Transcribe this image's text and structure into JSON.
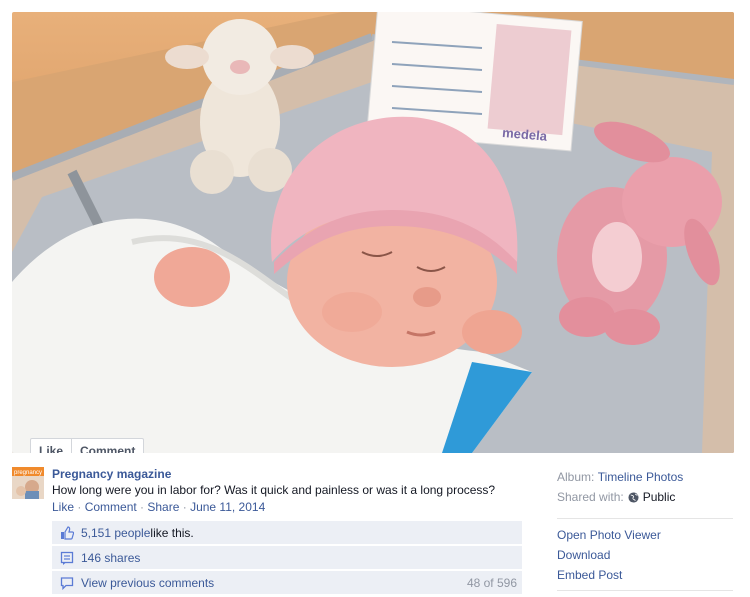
{
  "photo": {
    "alt_scene": "newborn-in-bassinet",
    "tag_brand": "medela",
    "actions": {
      "like_label": "Like",
      "comment_label": "Comment"
    }
  },
  "post": {
    "page_name": "Pregnancy magazine",
    "avatar_text": "pregnancy",
    "caption": "How long were you in labor for? Was it quick and painless or was it a long process?",
    "actions": {
      "like_label": "Like",
      "comment_label": "Comment",
      "share_label": "Share",
      "separator": " · ",
      "date": "June 11, 2014"
    }
  },
  "feedback": {
    "likes_count": "5,151 people",
    "likes_suffix": " like this.",
    "shares": "146 shares",
    "view_previous": "View previous comments",
    "comment_count": "48 of 596"
  },
  "sidebar": {
    "album_label": "Album:",
    "album_value": "Timeline Photos",
    "shared_label": "Shared with:",
    "shared_value": "Public",
    "links": [
      "Open Photo Viewer",
      "Download",
      "Embed Post"
    ]
  },
  "colors": {
    "link": "#3b5998",
    "meta": "#9197a3",
    "feedback_bg": "#eceff5"
  }
}
